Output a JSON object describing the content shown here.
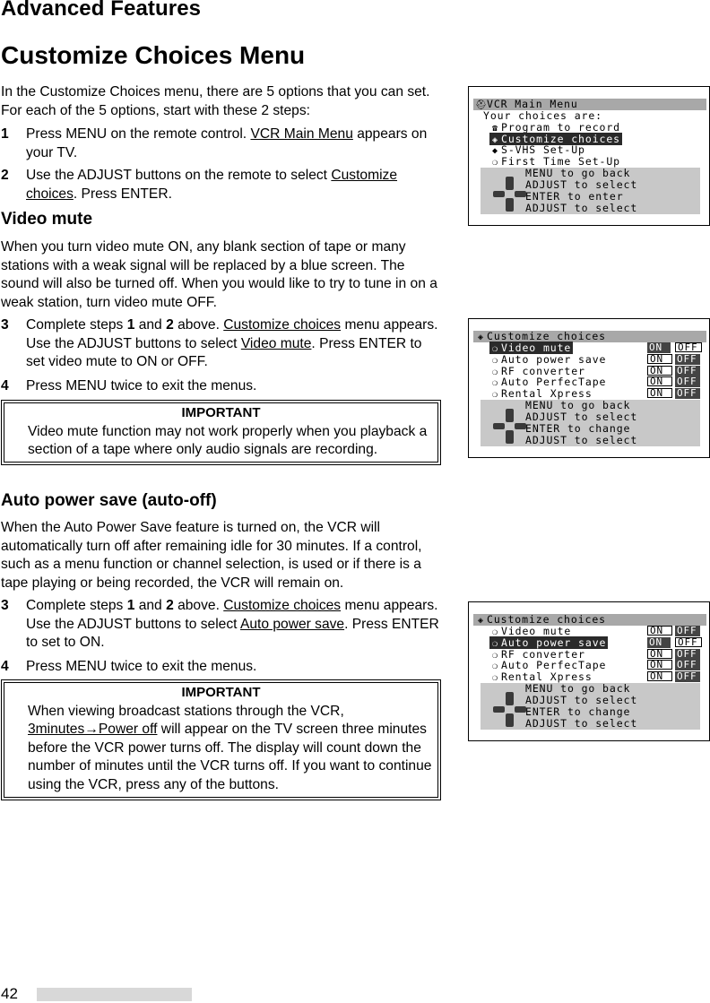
{
  "page": {
    "section_header": "Advanced Features",
    "title": "Customize Choices Menu",
    "page_number": "42"
  },
  "intro": {
    "text": "In the Customize Choices menu, there are 5 options that you can set.  For each of the 5 options, start with these 2 steps:",
    "steps": [
      {
        "num": "1",
        "pre": "Press MENU on the remote control.  ",
        "link": "VCR Main Menu",
        "post": " appears on your TV."
      },
      {
        "num": "2",
        "pre": "Use the ADJUST buttons on the remote to select ",
        "link": "Customize choices",
        "post": ".  Press ENTER."
      }
    ]
  },
  "video_mute": {
    "heading": "Video mute",
    "text": "When you turn video mute ON, any blank section of tape or many stations with a weak signal will be replaced by a blue screen.  The sound will also be turned off.  When you would like to try to tune in on a weak station, turn video mute OFF.",
    "step3": {
      "num": "3",
      "a": "Complete steps ",
      "b1": "1",
      "c": " and ",
      "b2": "2",
      "d": " above.  ",
      "link1": "Customize choices",
      "e": " menu appears.  Use the ADJUST buttons to select ",
      "link2": "Video mute",
      "f": ".  Press ENTER to set video mute to ON or OFF."
    },
    "step4": {
      "num": "4",
      "text": "Press MENU twice to exit the menus."
    },
    "important": {
      "title": "IMPORTANT",
      "text": "Video mute function may not work properly when you playback a section of a tape where only audio signals are recording."
    }
  },
  "auto_power": {
    "heading": "Auto power save (auto-off)",
    "text": "When the Auto Power Save feature is turned on, the VCR will automatically turn off after remaining idle for 30 minutes.  If a control, such as a menu function or channel selection, is used or if there is a tape playing or being recorded, the VCR will remain on.",
    "step3": {
      "num": "3",
      "a": "Complete steps ",
      "b1": "1",
      "c": " and ",
      "b2": "2",
      "d": " above.  ",
      "link1": "Customize choices",
      "e": " menu appears.  Use the ADJUST buttons to select ",
      "link2": "Auto power save",
      "f": ".  Press ENTER to set to ON."
    },
    "step4": {
      "num": "4",
      "text": "Press MENU twice to exit the menus."
    },
    "important": {
      "title": "IMPORTANT",
      "line1": "When viewing broadcast stations through the VCR,",
      "link": "3minutes→Power off",
      "rest": " will appear on the TV screen three minutes before the VCR power turns off.  The display will count down the number of minutes until the VCR turns off.  If you want to continue using the VCR, press any of the buttons."
    }
  },
  "osd_main": {
    "title": "VCR Main Menu",
    "title_icon": "antenna-icon",
    "subtitle": "Your choices are:",
    "items": [
      {
        "label": "Program to record",
        "icon": "telephone-icon",
        "selected": false
      },
      {
        "label": "Customize choices",
        "icon": "cube-icon",
        "selected": true
      },
      {
        "label": "S-VHS Set-Up",
        "icon": "diamond-icon",
        "selected": false
      },
      {
        "label": "First Time Set-Up",
        "icon": "globe-icon",
        "selected": false
      }
    ],
    "help": [
      "MENU to go back",
      "ADJUST to select",
      "ENTER  to enter",
      "ADJUST to select"
    ]
  },
  "osd_custom_1": {
    "title": "Customize choices",
    "items": [
      {
        "label": "Video mute",
        "selected": true,
        "on": "ON",
        "off": "OFF",
        "value": "OFF"
      },
      {
        "label": "Auto power save",
        "selected": false,
        "on": "ON",
        "off": "OFF",
        "value": "ON"
      },
      {
        "label": "RF converter",
        "selected": false,
        "on": "ON",
        "off": "OFF",
        "value": "ON"
      },
      {
        "label": "Auto PerfecTape",
        "selected": false,
        "on": "ON",
        "off": "OFF",
        "value": "ON"
      },
      {
        "label": "Rental Xpress",
        "selected": false,
        "on": "ON",
        "off": "OFF",
        "value": "ON"
      }
    ],
    "help": [
      "MENU to go back",
      "ADJUST to select",
      "ENTER  to change",
      "ADJUST to select"
    ]
  },
  "osd_custom_2": {
    "title": "Customize choices",
    "items": [
      {
        "label": "Video mute",
        "selected": false,
        "on": "ON",
        "off": "OFF",
        "value": "ON"
      },
      {
        "label": "Auto power save",
        "selected": true,
        "on": "ON",
        "off": "OFF",
        "value": "OFF"
      },
      {
        "label": "RF converter",
        "selected": false,
        "on": "ON",
        "off": "OFF",
        "value": "ON"
      },
      {
        "label": "Auto PerfecTape",
        "selected": false,
        "on": "ON",
        "off": "OFF",
        "value": "ON"
      },
      {
        "label": "Rental Xpress",
        "selected": false,
        "on": "ON",
        "off": "OFF",
        "value": "ON"
      }
    ],
    "help": [
      "MENU to go back",
      "ADJUST to select",
      "ENTER  to change",
      "ADJUST to select"
    ]
  }
}
